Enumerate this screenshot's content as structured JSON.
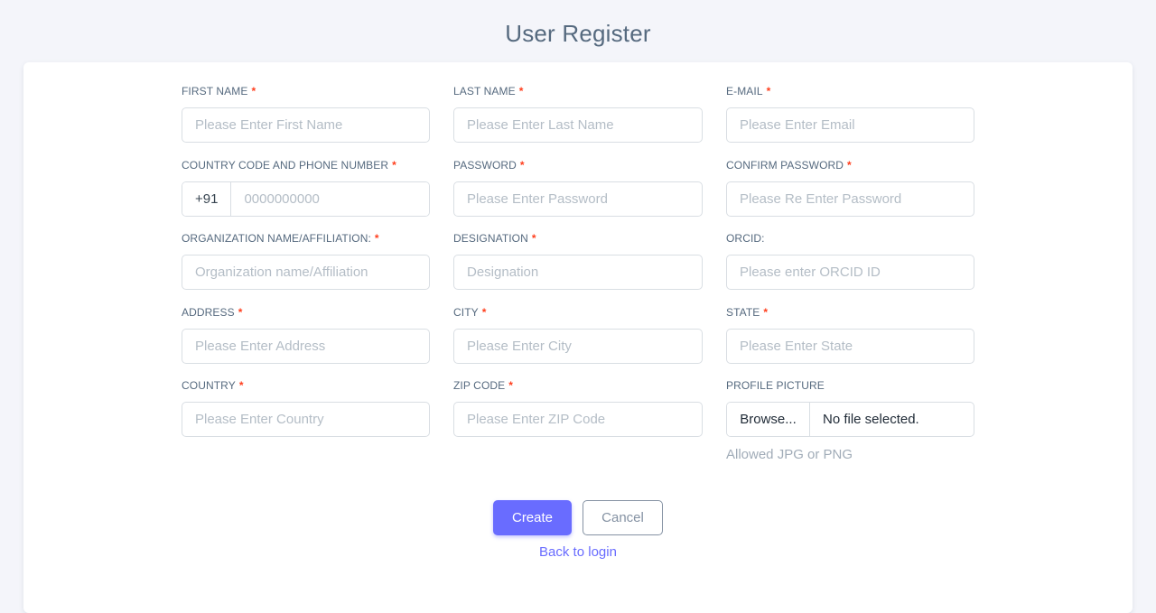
{
  "page": {
    "title": "User Register"
  },
  "colors": {
    "accent": "#696cff",
    "required": "#ff3e1d",
    "background": "#f4f5fa"
  },
  "form": {
    "required_mark": "*",
    "first_name": {
      "label": "FIRST NAME",
      "placeholder": "Please Enter First Name"
    },
    "last_name": {
      "label": "LAST NAME",
      "placeholder": "Please Enter Last Name"
    },
    "email": {
      "label": "E-MAIL",
      "placeholder": "Please Enter Email"
    },
    "phone": {
      "label": "COUNTRY CODE AND PHONE NUMBER",
      "code": "+91",
      "placeholder": "0000000000"
    },
    "password": {
      "label": "PASSWORD",
      "placeholder": "Please Enter Password"
    },
    "confirm_password": {
      "label": "CONFIRM PASSWORD",
      "placeholder": "Please Re Enter Password"
    },
    "organization": {
      "label": "ORGANIZATION NAME/AFFILIATION:",
      "placeholder": "Organization name/Affiliation"
    },
    "designation": {
      "label": "DESIGNATION",
      "placeholder": "Designation"
    },
    "orcid": {
      "label": "ORCID:",
      "placeholder": "Please enter ORCID ID"
    },
    "address": {
      "label": "ADDRESS",
      "placeholder": "Please Enter Address"
    },
    "city": {
      "label": "CITY",
      "placeholder": "Please Enter City"
    },
    "state": {
      "label": "STATE",
      "placeholder": "Please Enter State"
    },
    "country": {
      "label": "COUNTRY",
      "placeholder": "Please Enter Country"
    },
    "zip": {
      "label": "ZIP CODE",
      "placeholder": "Please Enter ZIP Code"
    },
    "profile_picture": {
      "label": "PROFILE PICTURE",
      "browse": "Browse...",
      "file_status": "No file selected.",
      "hint": "Allowed JPG or PNG"
    }
  },
  "actions": {
    "create": "Create",
    "cancel": "Cancel",
    "back_to_login": "Back to login"
  }
}
